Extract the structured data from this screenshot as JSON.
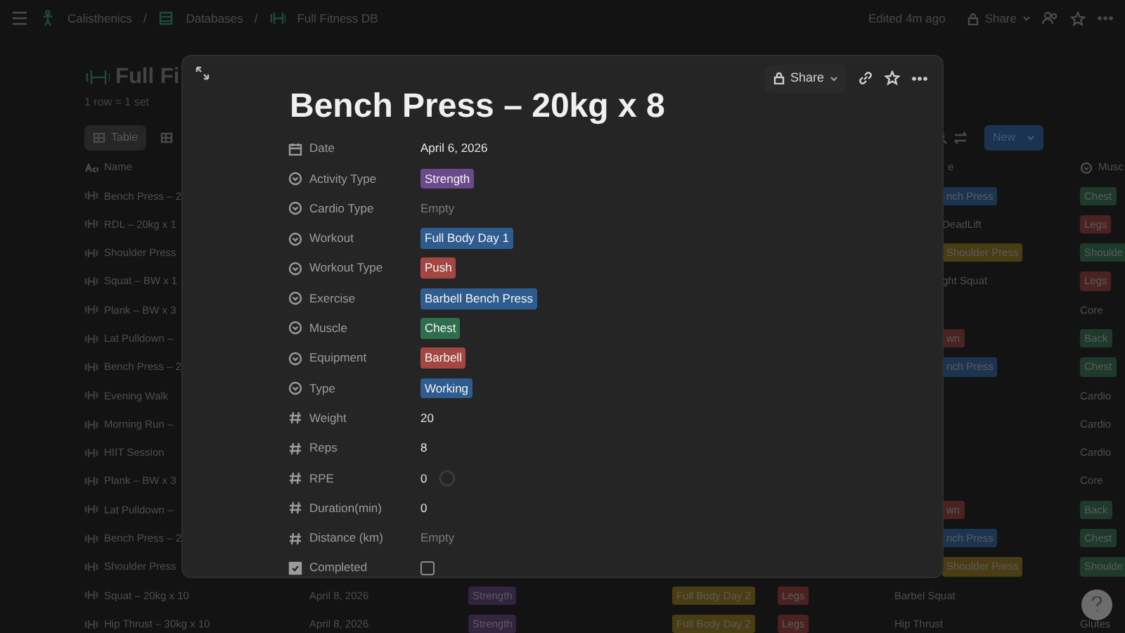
{
  "topbar": {
    "breadcrumbs": [
      "Calisthenics",
      "Databases",
      "Full Fitness DB"
    ],
    "separator": "/",
    "edited": "Edited 4m ago",
    "share": "Share"
  },
  "database": {
    "title": "Full Fi",
    "description": "1 row = 1 set",
    "tabs": [
      {
        "label": "Table",
        "selected": true
      },
      {
        "selected": false
      }
    ],
    "new_button": "New",
    "columns": {
      "name": "Name",
      "exercise": "e",
      "muscle": "Musc"
    },
    "rows": [
      {
        "kind": "covered",
        "name": "Bench Press – 2",
        "exercise": {
          "text": "nch Press",
          "color": "#1d3450"
        },
        "muscle": {
          "text": "Chest",
          "color": "#1e3a2b"
        }
      },
      {
        "kind": "covered",
        "name": "RDL – 20kg x 1",
        "exercise": {
          "text": "DeadLift"
        },
        "muscle": {
          "text": "Legs",
          "color": "#4a2220"
        }
      },
      {
        "kind": "covered",
        "name": "Shoulder Press",
        "exercise": {
          "text": "Shoulder Press",
          "color": "#4a3d14"
        },
        "muscle": {
          "text": "Shoulde",
          "color": "#1e3a2b"
        }
      },
      {
        "kind": "covered",
        "name": "Squat – BW x 1",
        "exercise": {
          "text": "ght Squat"
        },
        "muscle": {
          "text": "Legs",
          "color": "#4a2220"
        }
      },
      {
        "kind": "covered",
        "name": "Plank – BW x 3",
        "muscle": {
          "text": "Core"
        }
      },
      {
        "kind": "covered",
        "name": "Lat Pulldown –",
        "exercise": {
          "text": "wn",
          "color": "#4a2220"
        },
        "muscle": {
          "text": "Back",
          "color": "#1e3a2b"
        }
      },
      {
        "kind": "covered",
        "name": "Bench Press – 2",
        "exercise": {
          "text": "nch Press",
          "color": "#1d3450"
        },
        "muscle": {
          "text": "Chest",
          "color": "#1e3a2b"
        }
      },
      {
        "kind": "covered",
        "name": "Evening Walk",
        "muscle": {
          "text": "Cardio"
        }
      },
      {
        "kind": "covered",
        "name": "Morning Run –",
        "muscle": {
          "text": "Cardio"
        }
      },
      {
        "kind": "covered",
        "name": "HIIT Session",
        "muscle": {
          "text": "Cardio"
        }
      },
      {
        "kind": "covered",
        "name": "Plank – BW x 3",
        "muscle": {
          "text": "Core"
        }
      },
      {
        "kind": "covered",
        "name": "Lat Pulldown –",
        "exercise": {
          "text": "wn",
          "color": "#4a2220"
        },
        "muscle": {
          "text": "Back",
          "color": "#1e3a2b"
        }
      },
      {
        "kind": "covered",
        "name": "Bench Press – 2",
        "exercise": {
          "text": "nch Press",
          "color": "#1d3450"
        },
        "muscle": {
          "text": "Chest",
          "color": "#1e3a2b"
        }
      },
      {
        "kind": "covered",
        "name": "Shoulder Press",
        "exercise": {
          "text": "Shoulder Press",
          "color": "#4a3d14"
        },
        "muscle": {
          "text": "Shoulde",
          "color": "#1e3a2b"
        }
      },
      {
        "kind": "full",
        "name": "Squat – 20kg x 10",
        "date": "April 8, 2026",
        "activity": {
          "text": "Strength",
          "color": "#33243f"
        },
        "workout": {
          "text": "Full Body Day 2",
          "color": "#4a3d14"
        },
        "workout_type": {
          "text": "Legs",
          "color": "#4a2220"
        },
        "exercise": {
          "text": "Barbel Squat"
        }
      },
      {
        "kind": "full",
        "name": "Hip Thrust – 30kg x 10",
        "date": "April 8, 2026",
        "activity": {
          "text": "Strength",
          "color": "#33243f"
        },
        "workout": {
          "text": "Full Body Day 2",
          "color": "#4a3d14"
        },
        "workout_type": {
          "text": "Legs",
          "color": "#4a2220"
        },
        "exercise": {
          "text": "Hip Thrust"
        },
        "muscle": {
          "text": "Glutes"
        }
      }
    ]
  },
  "modal": {
    "title": "Bench Press – 20kg x 8",
    "share": "Share",
    "properties": [
      {
        "kind": "date",
        "label": "Date",
        "value": "April 6, 2026"
      },
      {
        "kind": "select",
        "label": "Activity Type",
        "value": "Strength",
        "color": "#6b4a8c"
      },
      {
        "kind": "select",
        "label": "Cardio Type",
        "value": "Empty",
        "empty": true
      },
      {
        "kind": "select",
        "label": "Workout",
        "value": "Full Body Day 1",
        "color": "#2f5c8f"
      },
      {
        "kind": "select",
        "label": "Workout Type",
        "value": "Push",
        "color": "#a44742"
      },
      {
        "kind": "select",
        "label": "Exercise",
        "value": "Barbell Bench Press",
        "color": "#2f5c8f"
      },
      {
        "kind": "select",
        "label": "Muscle",
        "value": "Chest",
        "color": "#2f6e4c"
      },
      {
        "kind": "select",
        "label": "Equipment",
        "value": "Barbell",
        "color": "#a44742"
      },
      {
        "kind": "select",
        "label": "Type",
        "value": "Working",
        "color": "#2f5c8f"
      },
      {
        "kind": "number",
        "label": "Weight",
        "value": "20"
      },
      {
        "kind": "number",
        "label": "Reps",
        "value": "8"
      },
      {
        "kind": "rating",
        "label": "RPE",
        "value": "0"
      },
      {
        "kind": "number",
        "label": "Duration(min)",
        "value": "0"
      },
      {
        "kind": "number",
        "label": "Distance (km)",
        "value": "Empty",
        "empty": true
      },
      {
        "kind": "checkbox",
        "label": "Completed",
        "checked": false
      }
    ]
  }
}
